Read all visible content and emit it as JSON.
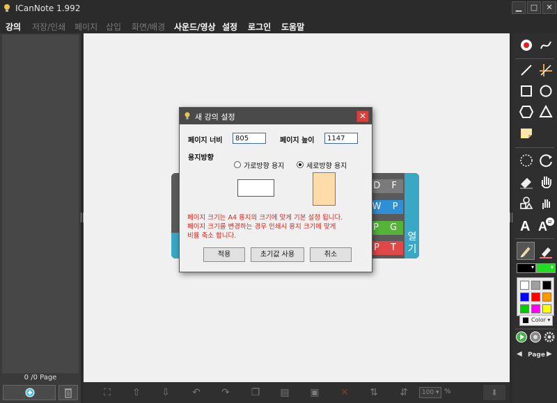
{
  "window": {
    "title": "ICanNote 1.992",
    "minimize": "▁",
    "maximize": "□",
    "close": "✕"
  },
  "menu": [
    {
      "label": "강의",
      "enabled": true
    },
    {
      "label": "저장/인쇄",
      "enabled": false
    },
    {
      "label": "페이지",
      "enabled": false
    },
    {
      "label": "삽입",
      "enabled": false
    },
    {
      "label": "화면/배경",
      "enabled": false
    },
    {
      "label": "사운드/영상",
      "enabled": true
    },
    {
      "label": "설정",
      "enabled": true
    },
    {
      "label": "로그인",
      "enabled": true
    },
    {
      "label": "도움말",
      "enabled": true
    }
  ],
  "left_panel": {
    "page_count": "0 /0 Page",
    "add_icon": "plus-circle-icon",
    "delete_icon": "trash-icon"
  },
  "start_card": {
    "file_types": [
      "D F",
      "W P",
      "P G",
      "P T"
    ],
    "open_label": [
      "열",
      "기"
    ]
  },
  "bottom_bar": {
    "zoom": "100",
    "zoom_unit": "%"
  },
  "dialog": {
    "title": "새 강의 설정",
    "page_width_label": "페이지 너비",
    "page_width_value": "805",
    "page_height_label": "페이지 높이",
    "page_height_value": "1147",
    "orientation_label": "용지방향",
    "landscape_label": "가로방향 용지",
    "portrait_label": "세로방향 용지",
    "selected_orientation": "portrait",
    "note_lines": [
      "페이지 크기는 A4 용지의 크기에 맞게 기본 설정 됩니다.",
      "페이지 크기를 변경하는 경우 인쇄시  용지 크기에  맞게",
      "비율 축소 합니다."
    ],
    "apply_label": "적용",
    "reset_label": "초기값 사용",
    "cancel_label": "취소"
  },
  "right_toolbar": {
    "pen_color": "#000000",
    "highlighter_color": "#22dd22",
    "palette": [
      "#ffffff",
      "#a0a0a0",
      "#000000",
      "#0000ff",
      "#ff0000",
      "#ff9900",
      "#00cc00",
      "#ff00ff",
      "#ffff00"
    ],
    "color_button_label": "Color",
    "page_nav_label": "Page"
  },
  "colors": {
    "accent_blue": "#3aa7c4",
    "pdf_chip": "#7a7a7a",
    "hwp_chip": "#2f8fd6",
    "jpg_chip": "#56b33a",
    "ppt_chip": "#e04848",
    "note_red": "#d9241c"
  }
}
